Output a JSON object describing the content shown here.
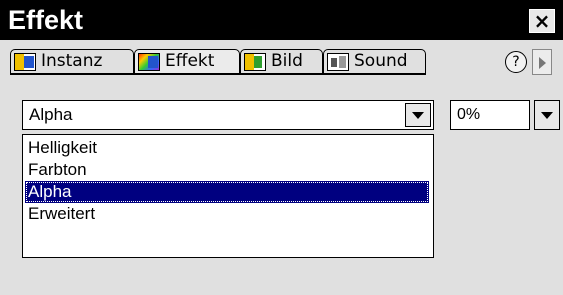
{
  "window": {
    "title": "Effekt",
    "close_label": "×"
  },
  "tabs": [
    {
      "label": "Instanz",
      "icon": "instance-icon"
    },
    {
      "label": "Effekt",
      "icon": "effect-icon",
      "active": true
    },
    {
      "label": "Bild",
      "icon": "image-icon"
    },
    {
      "label": "Sound",
      "icon": "sound-icon"
    }
  ],
  "help_label": "?",
  "effect_select": {
    "value": "Alpha",
    "options": [
      "Helligkeit",
      "Farbton",
      "Alpha",
      "Erweitert"
    ],
    "selected_index": 2
  },
  "amount": {
    "value": "0%"
  },
  "colors": {
    "titlebar": "#000000",
    "background": "#e0e0e0",
    "selection": "#000080"
  }
}
